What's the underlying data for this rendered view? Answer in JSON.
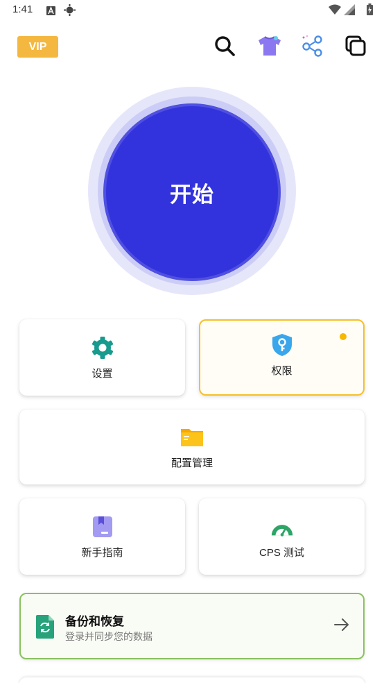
{
  "status_bar": {
    "time": "1:41",
    "icons_left": [
      "font-a-icon",
      "target-icon"
    ],
    "icons_right": [
      "wifi-icon",
      "signal-icon",
      "battery-icon"
    ]
  },
  "header": {
    "vip_label": "VIP",
    "icons": [
      "search-icon",
      "tshirt-theme-icon",
      "share-icon",
      "copy-windows-icon"
    ]
  },
  "start": {
    "label": "开始",
    "color": "#3333dd"
  },
  "grid": {
    "settings_label": "设置",
    "permission_label": "权限",
    "config_label": "配置管理",
    "guide_label": "新手指南",
    "cps_label": "CPS 测试"
  },
  "backup": {
    "title": "备份和恢复",
    "subtitle": "登录并同步您的数据"
  },
  "colors": {
    "vip": "#f4b840",
    "accent": "#3333dd",
    "permission_border": "#f6c02b",
    "backup_border": "#8ac25d"
  }
}
